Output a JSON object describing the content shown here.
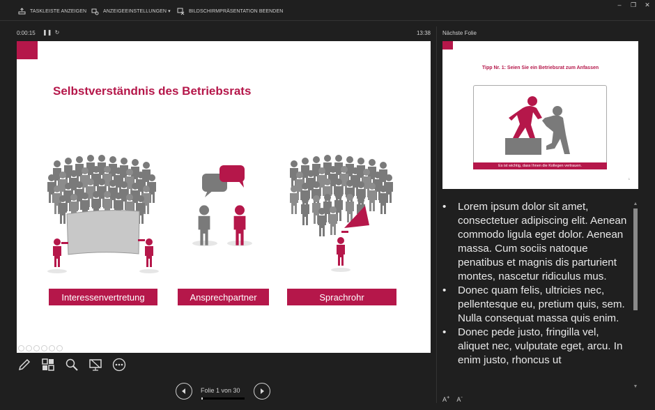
{
  "toolbar": {
    "show_taskbar": "TASKLEISTE ANZEIGEN",
    "display_settings": "ANZEIGEEINSTELLUNGEN ▾",
    "end_show": "BILDSCHIRMPRÄSENTATION BEENDEN"
  },
  "presenter": {
    "elapsed": "0:00:15",
    "clock": "13:38",
    "next_slide_label": "Nächste Folie",
    "slide_counter": "Folie 1 von 30",
    "progress_fraction": 0.033
  },
  "current_slide": {
    "title": "Selbstverständnis des Betriebsrats",
    "labels": [
      "Interessenvertretung",
      "Ansprechpartner",
      "Sprachrohr"
    ]
  },
  "next_slide": {
    "title": "Tipp Nr. 1: Seien Sie ein Betriebsrat zum Anfassen",
    "caption": "Es ist wichtig, dass Ihnen die Kollegen vertrauen.",
    "page_number": "1"
  },
  "notes": [
    "Lorem ipsum dolor sit amet, consectetuer adipiscing elit. Aenean commodo ligula eget dolor. Aenean massa. Cum sociis natoque penatibus et magnis dis parturient montes, nascetur ridiculus mus.",
    "Donec quam felis, ultricies nec, pellentesque eu, pretium quis, sem. Nulla consequat massa quis enim.",
    "Donec pede justo, fringilla vel, aliquet nec, vulputate eget, arcu. In enim justo, rhoncus ut"
  ],
  "colors": {
    "accent": "#b5174a",
    "figure_gray": "#6e6e6e",
    "background": "#1f1f1f"
  }
}
